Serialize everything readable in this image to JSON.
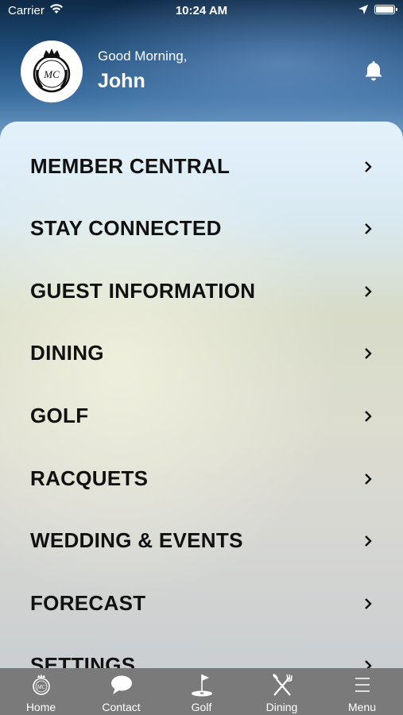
{
  "status_bar": {
    "carrier": "Carrier",
    "time": "10:24 AM"
  },
  "header": {
    "greeting": "Good Morning,",
    "user_name": "John",
    "logo_icon": "club-crest-logo",
    "notification_icon": "bell-icon"
  },
  "menu": {
    "items": [
      {
        "label": "MEMBER CENTRAL"
      },
      {
        "label": "STAY CONNECTED"
      },
      {
        "label": "GUEST INFORMATION"
      },
      {
        "label": "DINING"
      },
      {
        "label": "GOLF"
      },
      {
        "label": "RACQUETS"
      },
      {
        "label": "WEDDING & EVENTS"
      },
      {
        "label": "FORECAST"
      },
      {
        "label": "SETTINGS"
      }
    ]
  },
  "tab_bar": {
    "tabs": [
      {
        "label": "Home",
        "icon": "crest-icon"
      },
      {
        "label": "Contact",
        "icon": "chat-bubble-icon"
      },
      {
        "label": "Golf",
        "icon": "golf-flag-icon"
      },
      {
        "label": "Dining",
        "icon": "fork-knife-icon"
      },
      {
        "label": "Menu",
        "icon": "hamburger-menu-icon"
      }
    ]
  },
  "colors": {
    "tab_bar_bg": "#7a7a7a",
    "menu_text": "#111111",
    "header_text": "#ffffff"
  }
}
